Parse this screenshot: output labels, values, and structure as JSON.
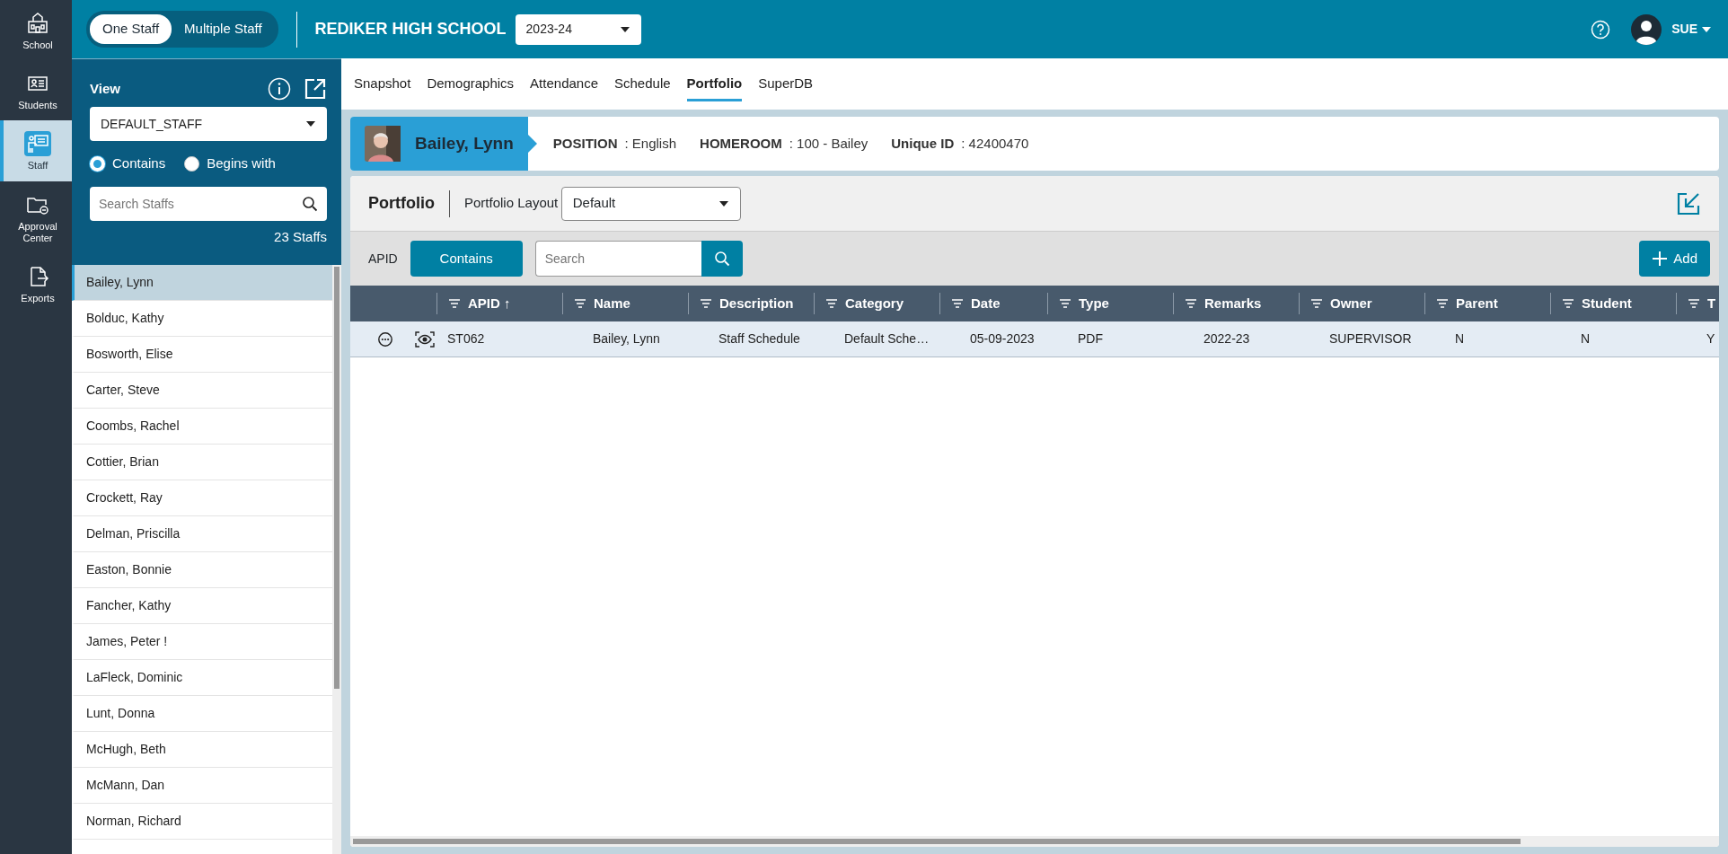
{
  "nav_rail": [
    {
      "label": "School",
      "selected": false
    },
    {
      "label": "Students",
      "selected": false
    },
    {
      "label": "Staff",
      "selected": true
    },
    {
      "label": "Approval Center",
      "selected": false
    },
    {
      "label": "Exports",
      "selected": false
    }
  ],
  "mode_toggle": [
    {
      "label": "One Staff",
      "selected": true
    },
    {
      "label": "Multiple Staff",
      "selected": false
    }
  ],
  "school_name": "REDIKER HIGH SCHOOL",
  "year_select": {
    "value": "2023-24"
  },
  "user": {
    "name": "SUE"
  },
  "sidebar": {
    "view_label": "View",
    "view_select": {
      "value": "DEFAULT_STAFF"
    },
    "match_options": [
      {
        "label": "Contains",
        "selected": true
      },
      {
        "label": "Begins with",
        "selected": false
      }
    ],
    "search": {
      "placeholder": "Search Staffs"
    },
    "count": "23 Staffs",
    "staff": [
      {
        "name": "Bailey, Lynn",
        "selected": true
      },
      {
        "name": "Bolduc, Kathy",
        "selected": false
      },
      {
        "name": "Bosworth, Elise",
        "selected": false
      },
      {
        "name": "Carter, Steve",
        "selected": false
      },
      {
        "name": "Coombs, Rachel",
        "selected": false
      },
      {
        "name": "Cottier, Brian",
        "selected": false
      },
      {
        "name": "Crockett, Ray",
        "selected": false
      },
      {
        "name": "Delman, Priscilla",
        "selected": false
      },
      {
        "name": "Easton, Bonnie",
        "selected": false
      },
      {
        "name": "Fancher, Kathy",
        "selected": false
      },
      {
        "name": "James, Peter !",
        "selected": false
      },
      {
        "name": "LaFleck, Dominic",
        "selected": false
      },
      {
        "name": "Lunt, Donna",
        "selected": false
      },
      {
        "name": "McHugh, Beth",
        "selected": false
      },
      {
        "name": "McMann, Dan",
        "selected": false
      },
      {
        "name": "Norman, Richard",
        "selected": false
      }
    ]
  },
  "tabs": [
    {
      "label": "Snapshot",
      "selected": false
    },
    {
      "label": "Demographics",
      "selected": false
    },
    {
      "label": "Attendance",
      "selected": false
    },
    {
      "label": "Schedule",
      "selected": false
    },
    {
      "label": "Portfolio",
      "selected": true
    },
    {
      "label": "SuperDB",
      "selected": false
    }
  ],
  "staff_header": {
    "name": "Bailey, Lynn",
    "fields": [
      {
        "label": "POSITION",
        "value": ": English"
      },
      {
        "label": "HOMEROOM",
        "value": ": 100 - Bailey"
      },
      {
        "label": "Unique ID",
        "value": ": 42400470"
      }
    ]
  },
  "portfolio": {
    "title": "Portfolio",
    "layout_label": "Portfolio Layout",
    "layout_select": {
      "value": "Default"
    },
    "filter_label": "APID",
    "filter_mode": "Contains",
    "search": {
      "placeholder": "Search"
    },
    "add_button": "Add",
    "columns": [
      {
        "label": "APID ↑"
      },
      {
        "label": "Name"
      },
      {
        "label": "Description"
      },
      {
        "label": "Category"
      },
      {
        "label": "Date"
      },
      {
        "label": "Type"
      },
      {
        "label": "Remarks"
      },
      {
        "label": "Owner"
      },
      {
        "label": "Parent"
      },
      {
        "label": "Student"
      },
      {
        "label": "T"
      }
    ],
    "rows": [
      {
        "cells": [
          "ST062",
          "Bailey, Lynn",
          "Staff Schedule",
          "Default Sche…",
          "05-09-2023",
          "PDF",
          "2022-23",
          "SUPERVISOR",
          "N",
          "N",
          "Y"
        ]
      }
    ]
  }
}
